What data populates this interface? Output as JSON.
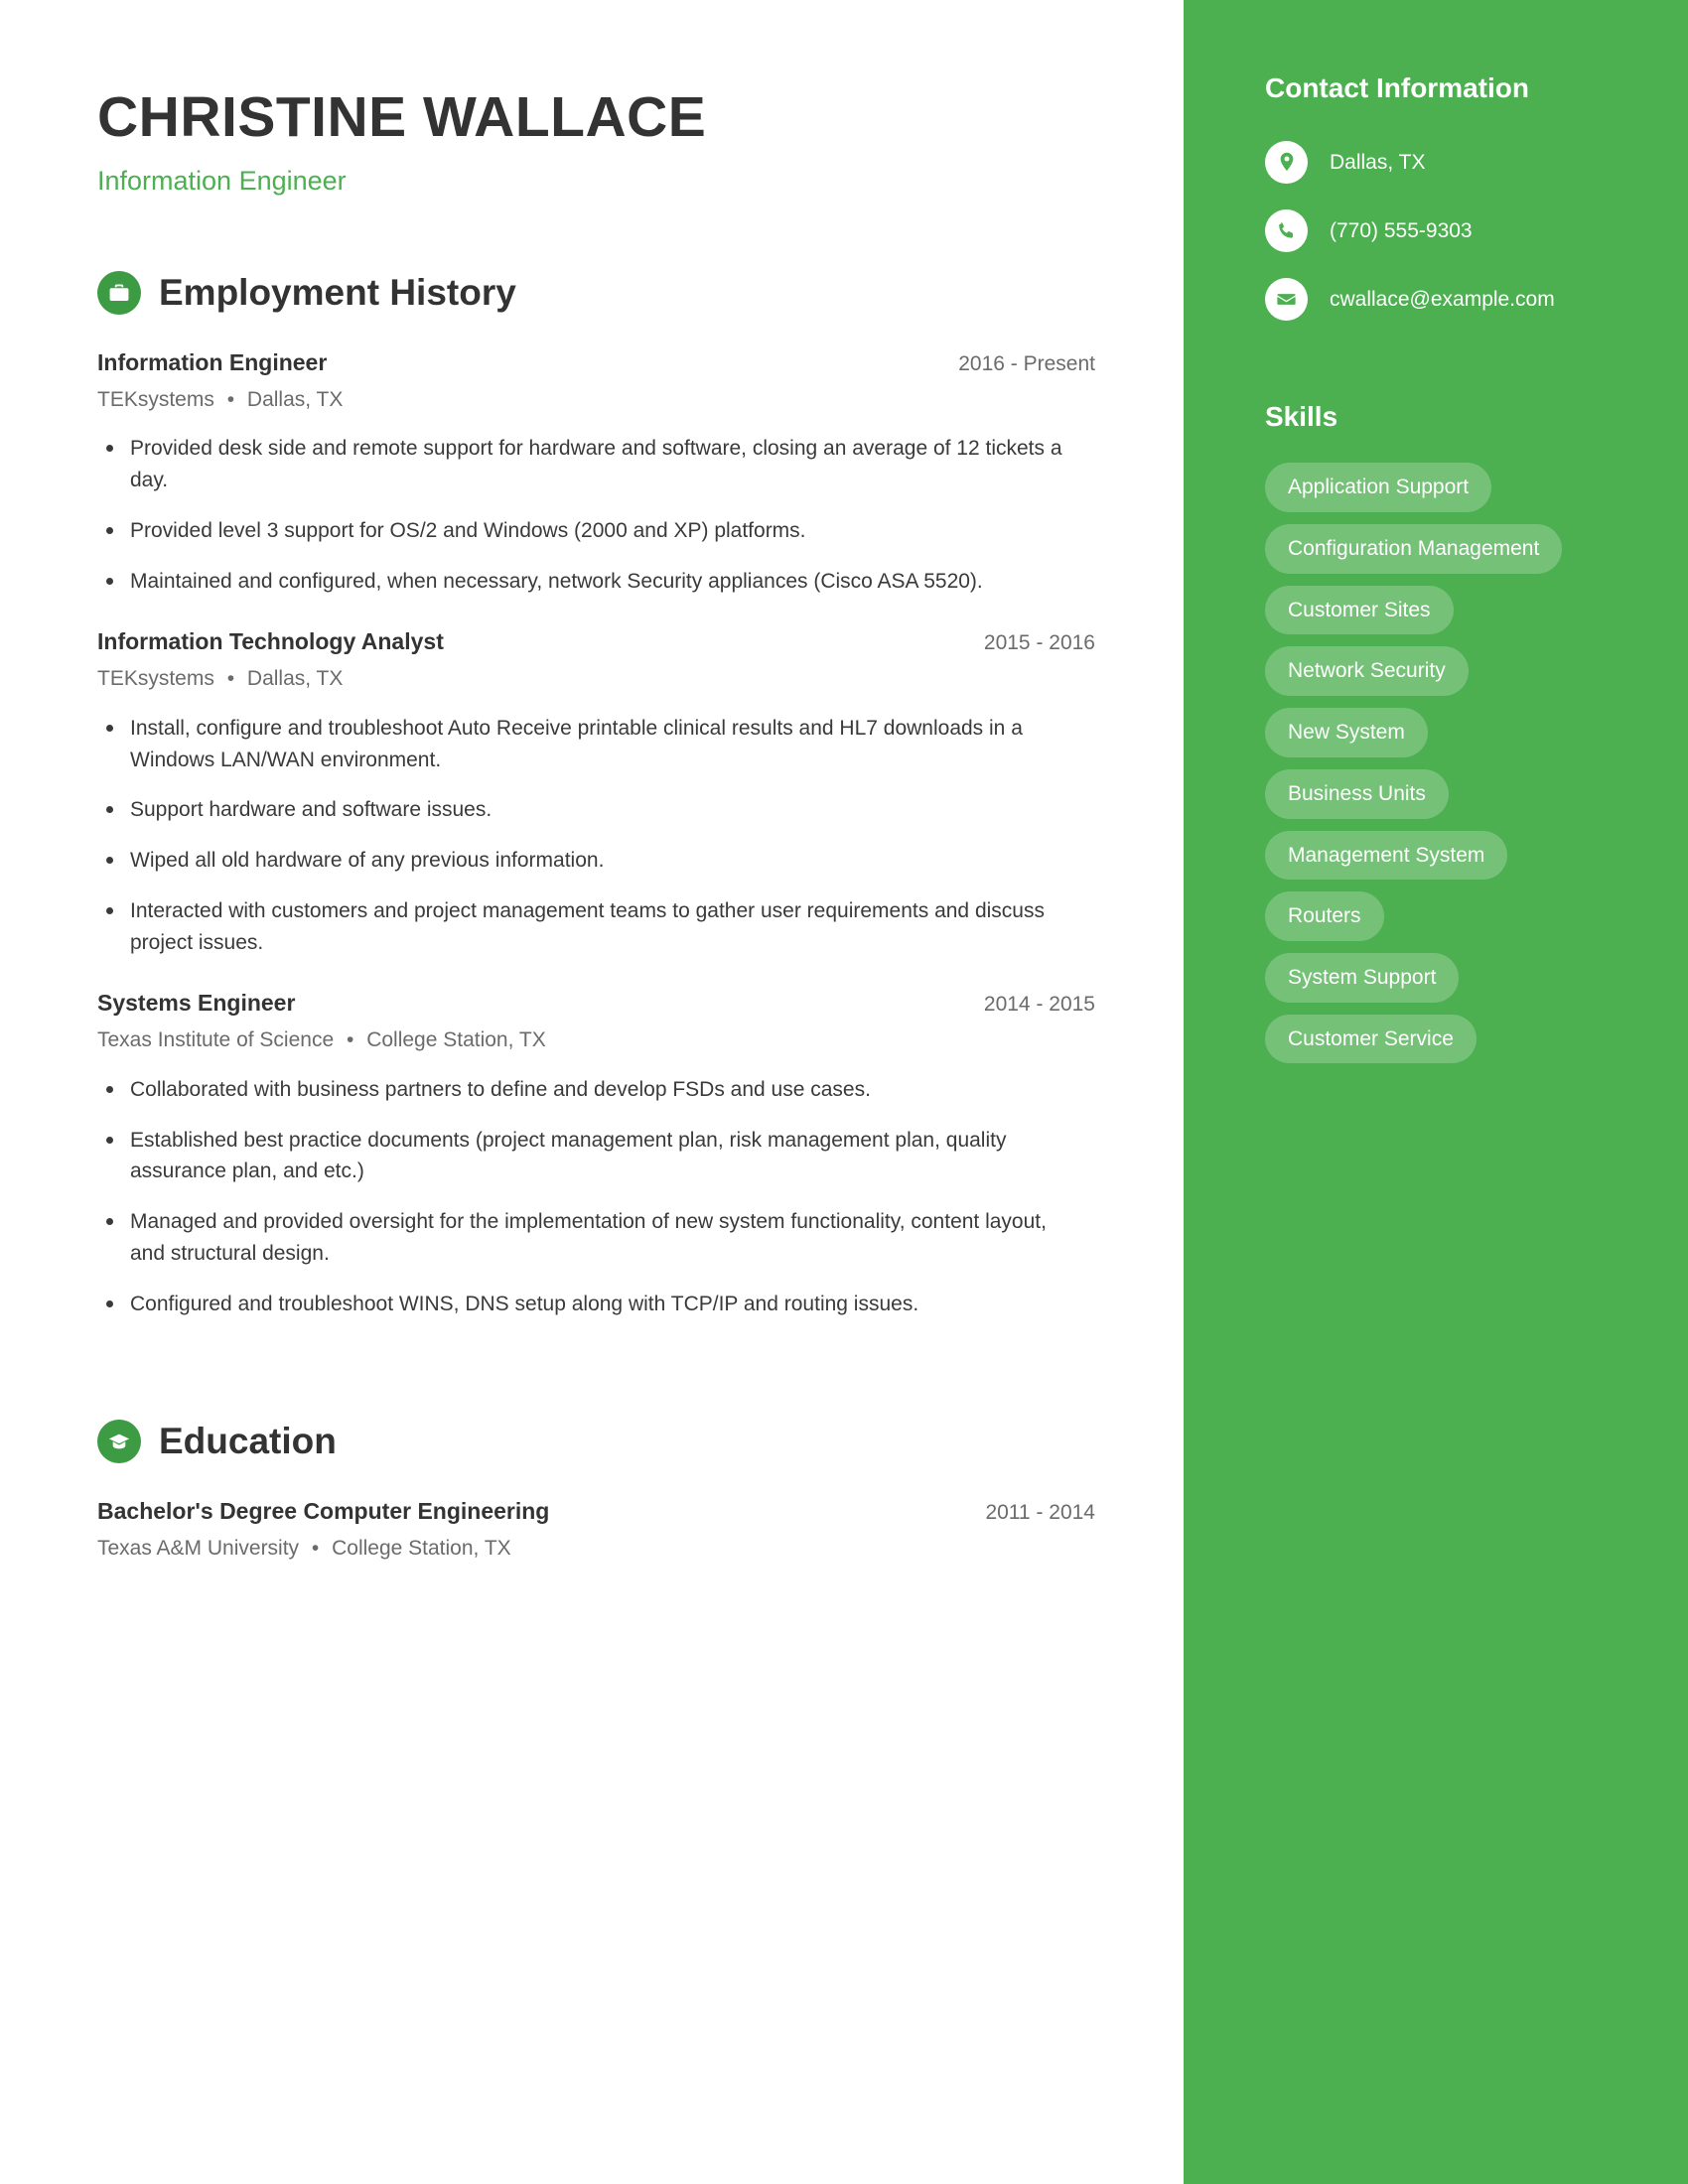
{
  "colors": {
    "accent_green": "#4CAF50",
    "icon_green": "#3C9B43",
    "heading_dark": "#333333",
    "body_text": "#3A3A3A",
    "muted_text": "#6B6B6B"
  },
  "header": {
    "name": "CHRISTINE WALLACE",
    "job_title": "Information Engineer"
  },
  "sections": {
    "employment": {
      "title": "Employment History",
      "icon": "briefcase-icon",
      "entries": [
        {
          "title": "Information Engineer",
          "dates": "2016 - Present",
          "organization": "TEKsystems",
          "location": "Dallas, TX",
          "bullets": [
            "Provided desk side and remote support for hardware and software, closing an average of 12 tickets a day.",
            "Provided level 3 support for OS/2 and Windows (2000 and XP) platforms.",
            "Maintained and configured, when necessary, network Security appliances (Cisco ASA 5520)."
          ]
        },
        {
          "title": "Information Technology Analyst",
          "dates": "2015 - 2016",
          "organization": "TEKsystems",
          "location": "Dallas, TX",
          "bullets": [
            "Install, configure and troubleshoot Auto Receive printable clinical results and HL7 downloads in a Windows LAN/WAN environment.",
            "Support hardware and software issues.",
            "Wiped all old hardware of any previous information.",
            "Interacted with customers and project management teams to gather user requirements and discuss project issues."
          ]
        },
        {
          "title": "Systems Engineer",
          "dates": "2014 - 2015",
          "organization": "Texas Institute of Science",
          "location": "College Station, TX",
          "bullets": [
            "Collaborated with business partners to define and develop FSDs and use cases.",
            "Established best practice documents (project management plan, risk management plan, quality assurance plan, and etc.)",
            "Managed and provided oversight for the implementation of new system functionality, content layout, and structural design.",
            "Configured and troubleshoot WINS, DNS setup along with TCP/IP and routing issues."
          ]
        }
      ]
    },
    "education": {
      "title": "Education",
      "icon": "graduation-cap-icon",
      "entries": [
        {
          "title": "Bachelor's Degree Computer Engineering",
          "dates": "2011 - 2014",
          "organization": "Texas A&M University",
          "location": "College Station, TX"
        }
      ]
    }
  },
  "sidebar": {
    "contact": {
      "title": "Contact Information",
      "items": [
        {
          "icon": "location-pin-icon",
          "value": "Dallas, TX"
        },
        {
          "icon": "phone-icon",
          "value": "(770) 555-9303"
        },
        {
          "icon": "envelope-icon",
          "value": "cwallace@example.com"
        }
      ]
    },
    "skills": {
      "title": "Skills",
      "items": [
        "Application Support",
        "Configuration Management",
        "Customer Sites",
        "Network Security",
        "New System",
        "Business Units",
        "Management System",
        "Routers",
        "System Support",
        "Customer Service"
      ]
    }
  },
  "separators": {
    "bullet_dot": "•"
  }
}
